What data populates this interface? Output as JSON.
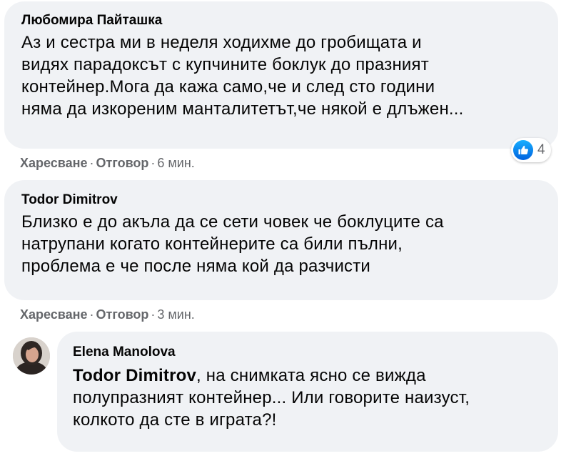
{
  "comments": [
    {
      "author": "Любомира Пайташка",
      "lines": [
        "Аз и сестра ми в неделя ходихме до гробищата и",
        "видях парадоксът с купчините боклук до празният",
        "контейнер.Мога да кажа само,че и след сто години",
        "няма да изкореним манталитетът,че някой е длъжен..."
      ],
      "actions": {
        "like": "Харесване",
        "reply": "Отговор",
        "time": "6 мин."
      },
      "reactions": {
        "count": "4",
        "icon": "like-icon",
        "color": "#1877f2"
      }
    },
    {
      "author": "Todor Dimitrov",
      "lines": [
        "Близко е до акъла да се сети човек че боклуците са",
        "натрупани когато контейнерите са били пълни,",
        "проблема е че после няма кой да разчисти"
      ],
      "actions": {
        "like": "Харесване",
        "reply": "Отговор",
        "time": "3 мин."
      }
    }
  ],
  "reply": {
    "author": "Elena Manolova",
    "mention": "Todor Dimitrov",
    "first_line_rest": ", на снимката ясно се вижда",
    "lines": [
      "полупразният контейнер... Или говорите наизуст,",
      "колкото да сте в играта?!"
    ],
    "avatar_icon": "user-avatar"
  },
  "dot_separator": "·",
  "colors": {
    "bubble_bg": "#f0f2f5",
    "meta_text": "#65676b",
    "body_text": "#050505"
  }
}
